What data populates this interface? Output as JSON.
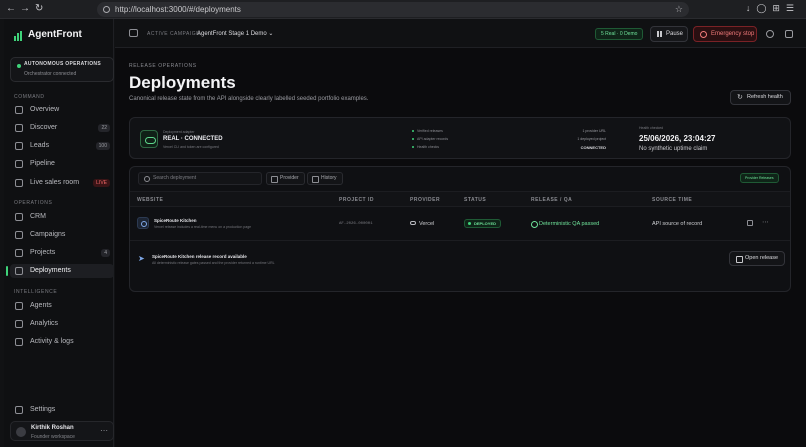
{
  "browser": {
    "url": "http://localhost:3000/#/deployments"
  },
  "sidebar": {
    "brand": "AgentFront",
    "autonomous": {
      "title": "AUTONOMOUS OPERATIONS",
      "status": "Orchestrator connected"
    },
    "sections": {
      "command": "COMMAND",
      "operations": "OPERATIONS",
      "intelligence": "INTELLIGENCE"
    },
    "items": [
      {
        "label": "Overview"
      },
      {
        "label": "Discover",
        "badge": "22"
      },
      {
        "label": "Leads",
        "badge": "100"
      },
      {
        "label": "Pipeline"
      },
      {
        "label": "Live sales room",
        "badge": "LIVE"
      },
      {
        "label": "CRM"
      },
      {
        "label": "Campaigns"
      },
      {
        "label": "Projects",
        "badge": "4"
      },
      {
        "label": "Deployments"
      },
      {
        "label": "Agents"
      },
      {
        "label": "Analytics"
      },
      {
        "label": "Activity & logs"
      },
      {
        "label": "Settings"
      }
    ],
    "user": {
      "name": "Kirthik Roshan",
      "role": "Founder workspace"
    }
  },
  "topbar": {
    "campaign_label": "ACTIVE CAMPAIGN",
    "campaign_value": "AgentFront Stage 1 Demo",
    "real_pill": "5 Real · 0 Demo",
    "pause": "Pause",
    "emergency": "Emergency stop"
  },
  "page": {
    "eyebrow": "RELEASE OPERATIONS",
    "title": "Deployments",
    "subtitle": "Canonical release state from the API alongside clearly labelled seeded portfolio examples.",
    "refresh": "Refresh health"
  },
  "status": {
    "adapter_label": "Deployment adapter",
    "state": "REAL · CONNECTED",
    "detail": "Vercel CLI and token are configured",
    "checks": [
      "Verified releases",
      "API adapter records",
      "Health checks"
    ],
    "provider_url": "1 provider URL",
    "deployed_project": "1 deployed project",
    "connected": "CONNECTED",
    "health_label": "Health checked",
    "health_time": "25/06/2026, 23:04:27",
    "uptime": "No synthetic uptime claim"
  },
  "table": {
    "search_placeholder": "Search deployment",
    "filters": [
      "Provider",
      "History"
    ],
    "provider_releases": "Provider Releases",
    "headers": [
      "WEBSITE",
      "PROJECT ID",
      "PROVIDER",
      "STATUS",
      "RELEASE / QA",
      "SOURCE TIME"
    ],
    "rows": [
      {
        "site": "SpiceRoute Kitchen",
        "desc": "Vercel release includes a real-time menu on a production page",
        "project_id": "AF-2026-000001",
        "provider": "Vercel",
        "status": "DEPLOYED",
        "qa": "Deterministic QA passed",
        "source_time": "API source of record"
      }
    ],
    "banner": {
      "title": "SpiceRoute Kitchen release record available",
      "desc": "All deterministic release gates passed and the provider returned a runtime URL",
      "button": "Open release"
    }
  }
}
